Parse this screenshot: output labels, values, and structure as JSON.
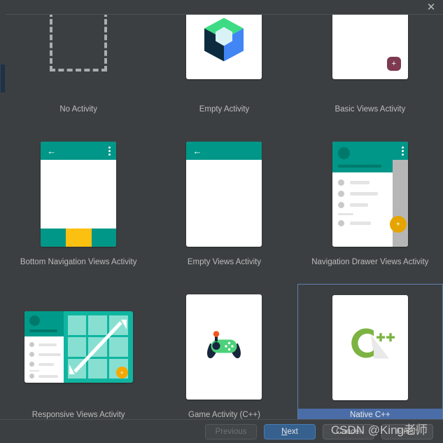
{
  "window": {
    "close_label": "✕"
  },
  "gallery": {
    "templates": [
      {
        "id": "no-activity",
        "label": "No Activity",
        "icon": "dashed-placeholder-icon",
        "selected": false
      },
      {
        "id": "empty-activity",
        "label": "Empty Activity",
        "icon": "jetpack-compose-cube-icon",
        "selected": false
      },
      {
        "id": "basic-views",
        "label": "Basic Views Activity",
        "icon": "blank-screen-with-fab-icon",
        "selected": false
      },
      {
        "id": "bottom-navigation",
        "label": "Bottom Navigation Views Activity",
        "icon": "bottom-navigation-phone-icon",
        "selected": false
      },
      {
        "id": "empty-views",
        "label": "Empty Views Activity",
        "icon": "empty-phone-icon",
        "selected": false
      },
      {
        "id": "navigation-drawer",
        "label": "Navigation Drawer Views Activity",
        "icon": "navigation-drawer-phone-icon",
        "selected": false
      },
      {
        "id": "responsive-views",
        "label": "Responsive Views Activity",
        "icon": "responsive-tablet-icon",
        "selected": false
      },
      {
        "id": "game-activity",
        "label": "Game Activity (C++)",
        "icon": "gamepad-icon",
        "selected": false
      },
      {
        "id": "native-cpp",
        "label": "Native C++",
        "icon": "cpp-logo-icon",
        "selected": true
      }
    ]
  },
  "footer": {
    "previous_label": "Previous",
    "next_label": "Next",
    "next_mnemonic": "N",
    "next_rest": "ext",
    "cancel_label": "Cancel",
    "finish_label": "Finish"
  },
  "watermark": {
    "text": "CSDN @King老师"
  },
  "colors": {
    "background": "#3c3f41",
    "selection_blue": "#4a6da7",
    "selection_border": "#5d7eb0",
    "primary_button": "#36618f",
    "teal": "#009688",
    "amber": "#fcc010",
    "cpp_green": "#7cb342"
  }
}
